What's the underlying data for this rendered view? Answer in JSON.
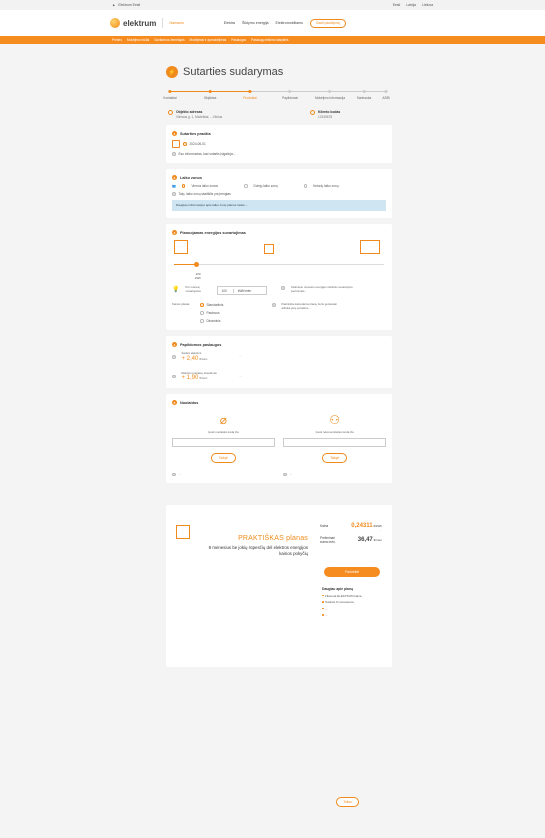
{
  "topbar": {
    "left_text": "Elektrum Eesti",
    "links": [
      "Eesti",
      "Latvija",
      "Lietuva"
    ]
  },
  "header": {
    "logo_text": "elektrum",
    "segment_select": "Namams",
    "nav": [
      "Elektra",
      "Šildymo energija",
      "Elektromobiliams"
    ],
    "cta": "Gauti pasiūlymą"
  },
  "subnav": [
    "Prekės",
    "Mokėjimo būdai",
    "Savitarnos žemėlapis",
    "Mokėjimai ir apmokėjimas",
    "Paslaugos",
    "Paslaugų teikimo taisyklės"
  ],
  "page": {
    "title": "Sutarties sudarymas"
  },
  "steps": [
    {
      "label": "Kontaktai",
      "state": "done"
    },
    {
      "label": "Objektas",
      "state": "done"
    },
    {
      "label": "Produktai",
      "state": "current"
    },
    {
      "label": "Papildomai",
      "state": "todo"
    },
    {
      "label": "Mokėjimo informacija",
      "state": "todo"
    },
    {
      "label": "Santrauka",
      "state": "todo"
    },
    {
      "label": "ASIB",
      "state": "todo"
    }
  ],
  "object": {
    "label": "Objekto adresas",
    "value": "Vilniaus g. 1, Mažeikiai, ...Vilnius"
  },
  "client": {
    "label": "Kliento kodas",
    "value": "12345678"
  },
  "section1": {
    "title": "Sutarties pradžia",
    "date": "2024-06-01",
    "note": "Esu informuotas, kad sutartis įsigalioja..."
  },
  "section2": {
    "title": "Laiko zonos",
    "options": [
      "Vienos laiko zonos",
      "Dviejų laiko zonų",
      "Keturių laiko zonų"
    ],
    "note": "Taip, laiko zonų skaitiklis yra įrengtas",
    "info": "Daugiau informacijos apie laiko zonų planus rasite...."
  },
  "section3": {
    "title": "Planuojamas energijos suvartojimas",
    "slider_value": "100",
    "slider_unit": "kWh",
    "consumption_label": "Per mėnesį suvartojama",
    "input_value": "100",
    "input_unit": "kWh/mėn",
    "hint1": "Kiekvieno mėnesio energijos vidutinio suvartojimo įvertinimas...",
    "plan_label": "Kainos planas",
    "plan_options": [
      "Standartinis",
      "Pastovus",
      "Dinaminis"
    ],
    "hint2": "Pasirinkite kainodaros planą, kuris geriausiai atitinka jūsų poreikius..."
  },
  "section4": {
    "title": "Papildomos paslaugos",
    "items": [
      {
        "name": "Saulės elektrinė",
        "price": "+ 2,40",
        "unit": "€/mėn",
        "desc": "..."
      },
      {
        "name": "Elektros prietaisų draudimas",
        "price": "+ 1,90",
        "unit": "€/mėn",
        "desc": "..."
      }
    ]
  },
  "section5": {
    "title": "Nuolaidos",
    "left_label": "Įvesk nuolaidos kodą čia",
    "right_label": "Įvesk rekomendacijos kodą čia",
    "btn": "Taikyti",
    "left_note": "...",
    "right_note": "..."
  },
  "promo": {
    "title": "PRAKTIŠKAS planas",
    "subtitle": "9 mėnesius be jokių rūpesčių dėl elektros energijos kainos pokyčių",
    "price_label": "Kaina",
    "price_value": "0,24311",
    "price_unit": "€/kWh",
    "price_note": "...",
    "monthly_label": "Preliminari suma mėn.",
    "monthly_value": "36,47",
    "monthly_unit": "€/mėn",
    "btn": "Pasirinkti",
    "benefits_title": "Daugiau apie planą",
    "benefits": [
      "Fiksuota ELEKTRUM kaina",
      "Sutartis 9 mėnesiams",
      "...",
      "..."
    ]
  },
  "next_btn": "Toliau"
}
